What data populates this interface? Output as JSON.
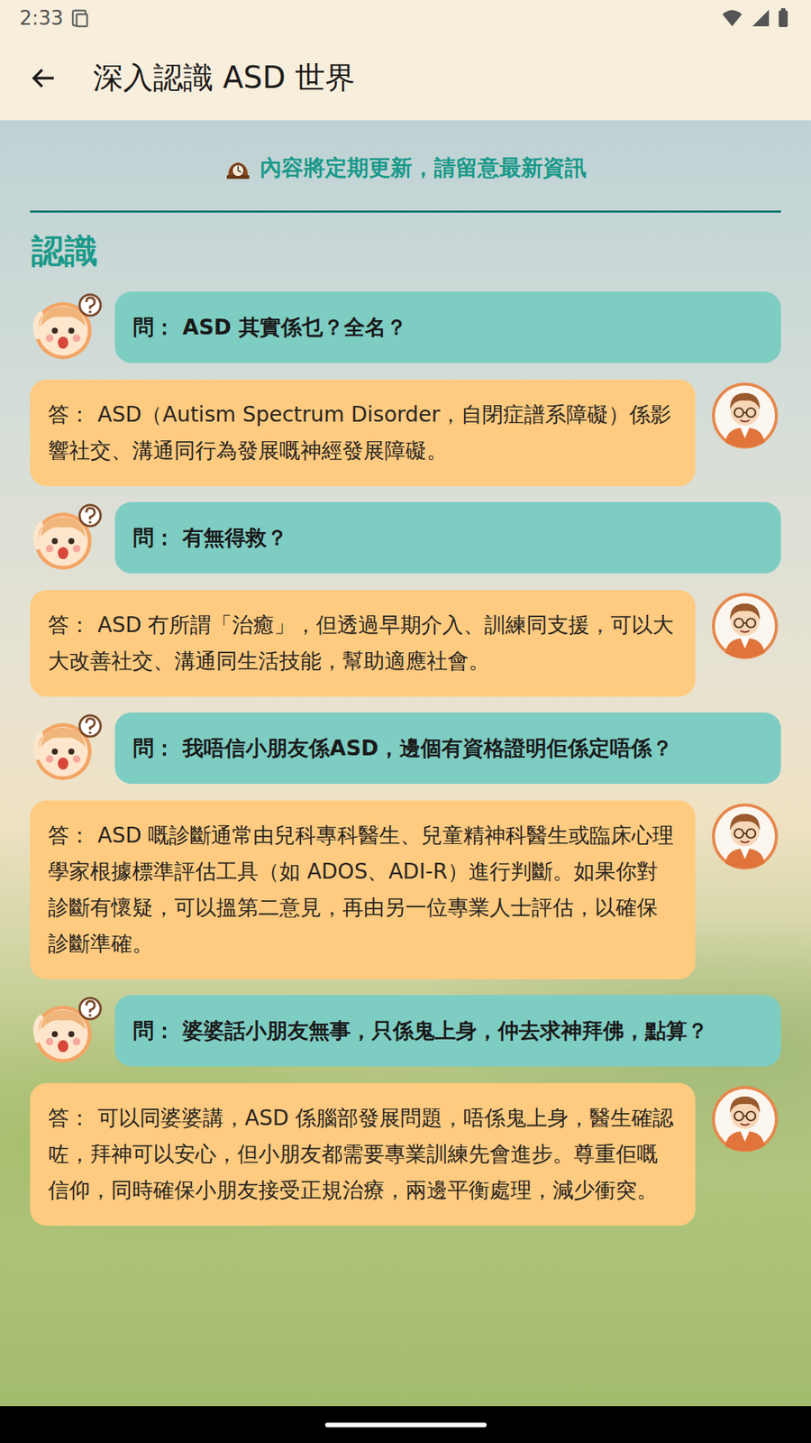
{
  "status_bar": {
    "time": "2:33"
  },
  "app_bar": {
    "title": "深入認識 ASD 世界"
  },
  "notice": "內容將定期更新，請留意最新資訊",
  "section": {
    "title": "認識"
  },
  "messages": [
    {
      "kind": "question",
      "label": "問：",
      "text": "ASD 其實係乜？全名？"
    },
    {
      "kind": "answer",
      "label": "答：",
      "text": "ASD（Autism Spectrum Disorder，自閉症譜系障礙）係影響社交、溝通同行為發展嘅神經發展障礙。"
    },
    {
      "kind": "question",
      "label": "問：",
      "text": "有無得救？"
    },
    {
      "kind": "answer",
      "label": "答：",
      "text": "ASD 冇所謂「治癒」，但透過早期介入、訓練同支援，可以大大改善社交、溝通同生活技能，幫助適應社會。"
    },
    {
      "kind": "question",
      "label": "問：",
      "text": "我唔信小朋友係ASD，邊個有資格證明佢係定唔係？"
    },
    {
      "kind": "answer",
      "label": "答：",
      "text": "ASD 嘅診斷通常由兒科專科醫生、兒童精神科醫生或臨床心理學家根據標準評估工具（如 ADOS、ADI-R）進行判斷。如果你對診斷有懷疑，可以搵第二意見，再由另一位專業人士評估，以確保診斷準確。"
    },
    {
      "kind": "question",
      "label": "問：",
      "text": "婆婆話小朋友無事，只係鬼上身，仲去求神拜佛，點算？"
    },
    {
      "kind": "answer",
      "label": "答：",
      "text": "可以同婆婆講，ASD 係腦部發展問題，唔係鬼上身，醫生確認咗，拜神可以安心，但小朋友都需要專業訓練先會進步。尊重佢嘅信仰，同時確保小朋友接受正規治療，兩邊平衡處理，減少衝突。"
    }
  ]
}
